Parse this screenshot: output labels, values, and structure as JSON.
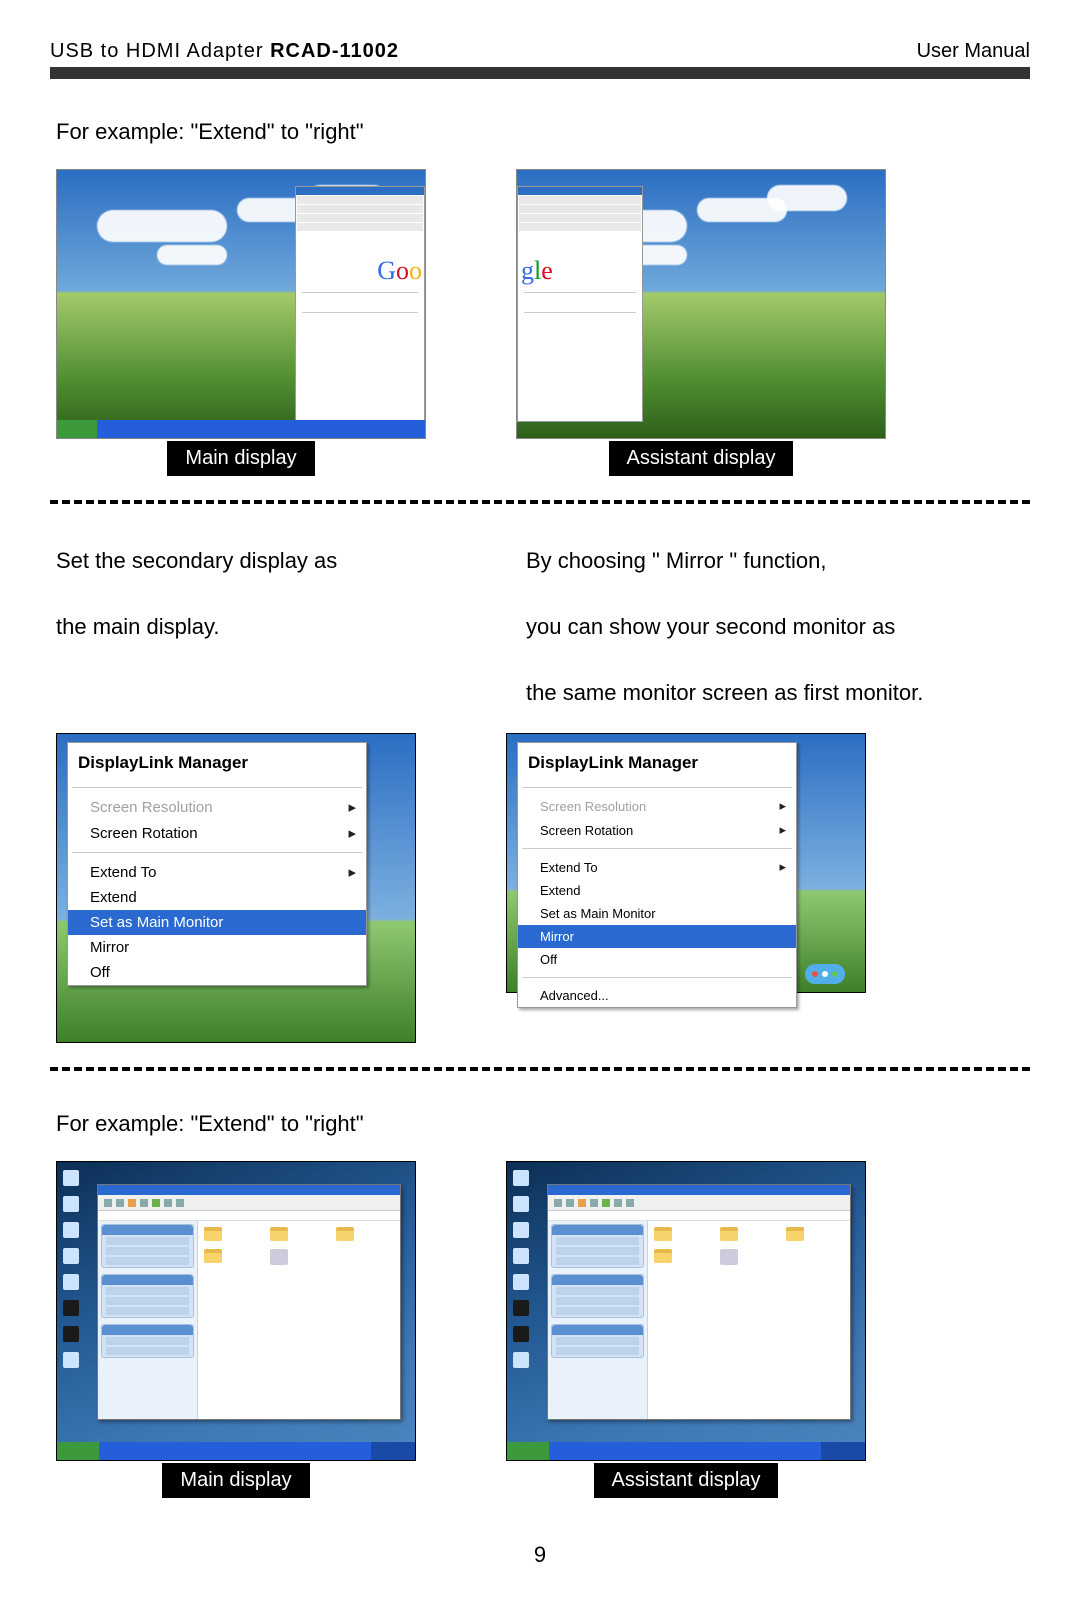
{
  "header": {
    "product_line": "USB to HDMI Adapter ",
    "model": "RCAD-11002",
    "doc_type": "User Manual"
  },
  "section1": {
    "intro": "For example: \"Extend\" to \"right\"",
    "main_caption": "Main display",
    "assistant_caption": "Assistant display",
    "browser_logo_left": "Goo",
    "browser_logo_right": "gle"
  },
  "section2": {
    "left_text_l1": "Set the secondary display as",
    "left_text_l2": "the main display.",
    "right_text_l1": "By choosing \" Mirror \" function,",
    "right_text_l2": "you can show your second monitor as",
    "right_text_l3": " the same monitor screen as first monitor.",
    "menu_left": {
      "title": "DisplayLink Manager",
      "items": [
        {
          "label": "Screen Resolution",
          "arrow": true,
          "disabled": true
        },
        {
          "label": "Screen Rotation",
          "arrow": true
        }
      ],
      "items2": [
        {
          "label": "Extend To",
          "arrow": true
        },
        {
          "label": "Extend"
        },
        {
          "label": "Set as Main Monitor",
          "selected": true,
          "dot": true
        },
        {
          "label": "Mirror"
        },
        {
          "label": "Off"
        }
      ]
    },
    "menu_right": {
      "title": "DisplayLink Manager",
      "items": [
        {
          "label": "Screen Resolution",
          "arrow": true,
          "disabled": true
        },
        {
          "label": "Screen Rotation",
          "arrow": true
        }
      ],
      "items2": [
        {
          "label": "Extend To",
          "arrow": true
        },
        {
          "label": "Extend"
        },
        {
          "label": "Set as Main Monitor"
        },
        {
          "label": "Mirror",
          "selected": true,
          "dot": true
        },
        {
          "label": "Off"
        }
      ],
      "items3": [
        {
          "label": "Advanced..."
        }
      ]
    }
  },
  "section3": {
    "intro": "For example: \"Extend\" to \"right\"",
    "main_caption": "Main display",
    "assistant_caption": "Assistant display"
  },
  "page_number": "9"
}
